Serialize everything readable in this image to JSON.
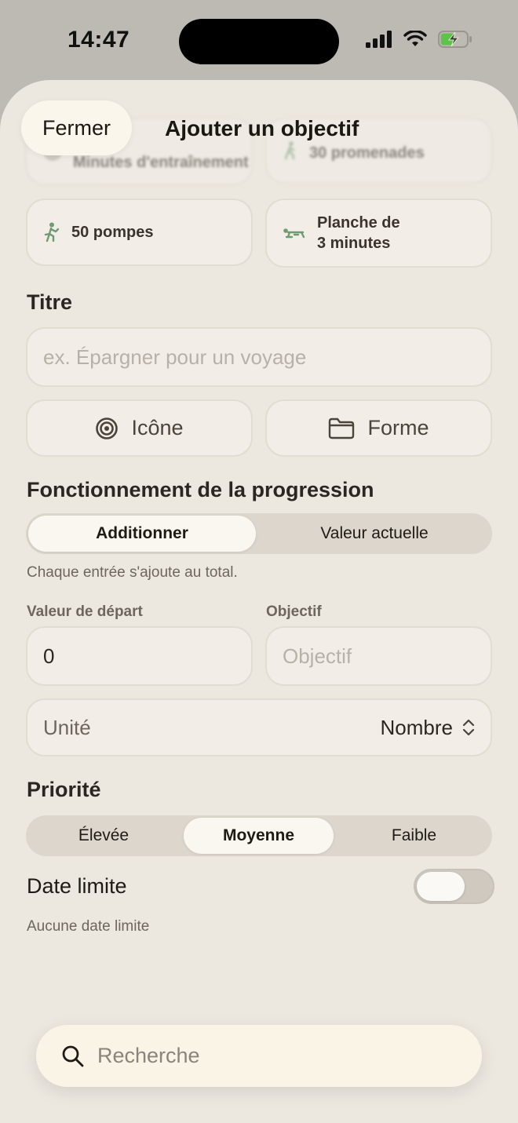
{
  "status_bar": {
    "time": "14:47"
  },
  "header": {
    "close_label": "Fermer",
    "title": "Ajouter un objectif"
  },
  "suggestions": {
    "row1_left": "Minutes d'entraînement",
    "row1_right": "30 promenades",
    "row2_left": "50 pompes",
    "row2_right_line1": "Planche de",
    "row2_right_line2": "3 minutes"
  },
  "title_section": {
    "label": "Titre",
    "placeholder": "ex. Épargner pour un voyage",
    "icon_button": "Icône",
    "shape_button": "Forme"
  },
  "progress_section": {
    "label": "Fonctionnement de la progression",
    "options": [
      "Additionner",
      "Valeur actuelle"
    ],
    "selected": "Additionner",
    "caption": "Chaque entrée s'ajoute au total."
  },
  "values": {
    "start_label": "Valeur de départ",
    "start_value": "0",
    "goal_label": "Objectif",
    "goal_placeholder": "Objectif",
    "unit_label": "Unité",
    "unit_value": "Nombre"
  },
  "priority_section": {
    "label": "Priorité",
    "options": [
      "Élevée",
      "Moyenne",
      "Faible"
    ],
    "selected": "Moyenne"
  },
  "deadline": {
    "label": "Date limite",
    "enabled": false,
    "caption": "Aucune date limite"
  },
  "search": {
    "placeholder": "Recherche"
  },
  "colors": {
    "sheet_bg": "#ece7df",
    "accent_green": "#6f9a72",
    "card_bg": "#f2eee7"
  }
}
